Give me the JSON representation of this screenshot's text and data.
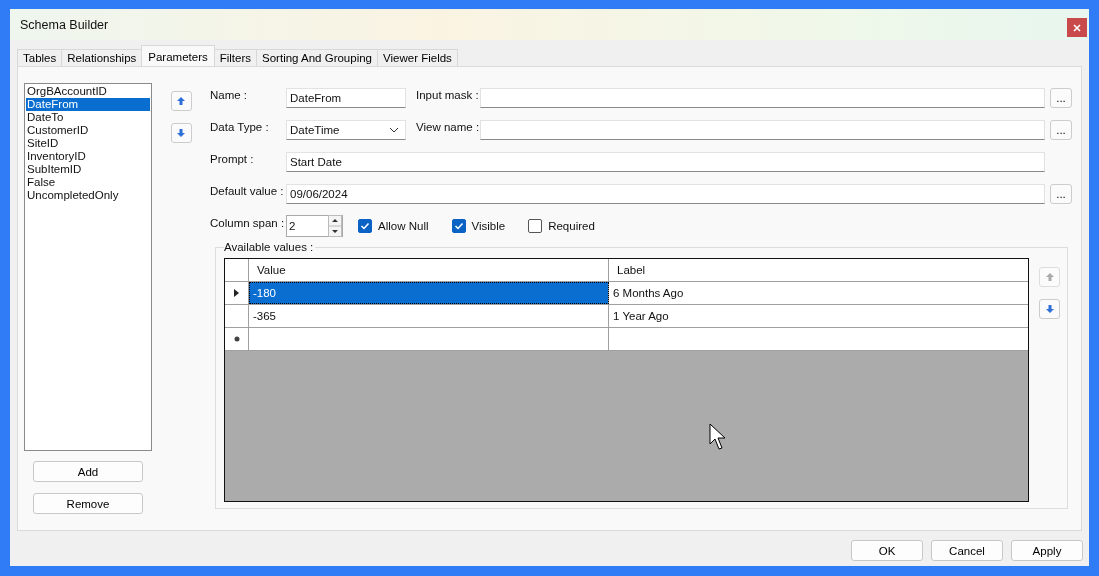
{
  "window": {
    "title": "Schema Builder"
  },
  "tabs": [
    {
      "label": "Tables",
      "selected": false
    },
    {
      "label": "Relationships",
      "selected": false
    },
    {
      "label": "Parameters",
      "selected": true
    },
    {
      "label": "Filters",
      "selected": false
    },
    {
      "label": "Sorting And Grouping",
      "selected": false
    },
    {
      "label": "Viewer Fields",
      "selected": false
    }
  ],
  "parameters": [
    {
      "label": "OrgBAccountID",
      "selected": false
    },
    {
      "label": "DateFrom",
      "selected": true
    },
    {
      "label": "DateTo",
      "selected": false
    },
    {
      "label": "CustomerID",
      "selected": false
    },
    {
      "label": "SiteID",
      "selected": false
    },
    {
      "label": "InventoryID",
      "selected": false
    },
    {
      "label": "SubItemID",
      "selected": false
    },
    {
      "label": "False",
      "selected": false
    },
    {
      "label": "UncompletedOnly",
      "selected": false
    }
  ],
  "add_button": "Add",
  "remove_button": "Remove",
  "form": {
    "name_label": "Name :",
    "name_value": "DateFrom",
    "input_mask_label": "Input mask :",
    "data_type_label": "Data Type :",
    "data_type_value": "DateTime",
    "view_name_label": "View name :",
    "prompt_label": "Prompt :",
    "prompt_value": "Start Date",
    "default_value_label": "Default value :",
    "default_value": "09/06/2024",
    "column_span_label": "Column span :",
    "column_span_value": "2",
    "browse_button": "..."
  },
  "checkboxes": [
    {
      "label": "Allow Null",
      "checked": true
    },
    {
      "label": "Visible",
      "checked": true
    },
    {
      "label": "Required",
      "checked": false
    }
  ],
  "available_values": {
    "title": "Available values :",
    "columns": [
      "Value",
      "Label"
    ],
    "rows": [
      {
        "value": "-180",
        "label": "6 Months Ago",
        "selected": true
      },
      {
        "value": "-365",
        "label": "1 Year Ago",
        "selected": false
      }
    ]
  },
  "buttons": [
    "OK",
    "Cancel",
    "Apply"
  ]
}
